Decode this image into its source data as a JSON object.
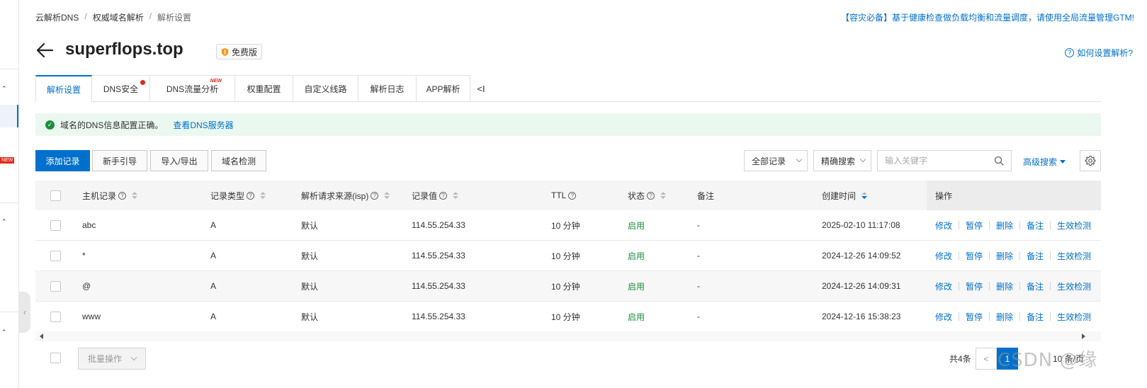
{
  "breadcrumb": [
    "云解析DNS",
    "权威域名解析",
    "解析设置"
  ],
  "breadcrumb_sep": "/",
  "top_notice": "【容灾必备】基于健康检查做负载均衡和流量调度，请使用全局流量管理GTM!",
  "domain": "superflops.top",
  "plan_badge": "免费版",
  "help_link": "如何设置解析?",
  "left_sidebar": {
    "new_tag": "NEW"
  },
  "tabs": [
    {
      "label": "解析设置",
      "active": true
    },
    {
      "label": "DNS安全",
      "badge": "dot"
    },
    {
      "label": "DNS流量分析",
      "badge": "NEW"
    },
    {
      "label": "权重配置"
    },
    {
      "label": "自定义线路"
    },
    {
      "label": "解析日志"
    },
    {
      "label": "APP解析"
    }
  ],
  "tab_collapse": "<I",
  "dns_status": {
    "message": "域名的DNS信息配置正确。",
    "link": "查看DNS服务器"
  },
  "toolbar": {
    "add_record": "添加记录",
    "guide": "新手引导",
    "import_export": "导入/导出",
    "domain_check": "域名检测",
    "record_filter": "全部记录",
    "search_mode": "精确搜索",
    "search_placeholder": "输入关键字",
    "advanced_search": "高级搜索"
  },
  "table": {
    "headers": {
      "host": "主机记录",
      "type": "记录类型",
      "line": "解析请求来源(isp)",
      "value": "记录值",
      "ttl": "TTL",
      "status": "状态",
      "remark": "备注",
      "created": "创建时间",
      "actions": "操作"
    },
    "actions": [
      "修改",
      "暂停",
      "删除",
      "备注",
      "生效检测"
    ],
    "rows": [
      {
        "host": "abc",
        "type": "A",
        "line": "默认",
        "value": "114.55.254.33",
        "ttl": "10 分钟",
        "status": "启用",
        "remark": "-",
        "created": "2025-02-10 11:17:08"
      },
      {
        "host": "*",
        "type": "A",
        "line": "默认",
        "value": "114.55.254.33",
        "ttl": "10 分钟",
        "status": "启用",
        "remark": "-",
        "created": "2024-12-26 14:09:52"
      },
      {
        "host": "@",
        "type": "A",
        "line": "默认",
        "value": "114.55.254.33",
        "ttl": "10 分钟",
        "status": "启用",
        "remark": "-",
        "created": "2024-12-26 14:09:31"
      },
      {
        "host": "www",
        "type": "A",
        "line": "默认",
        "value": "114.55.254.33",
        "ttl": "10 分钟",
        "status": "启用",
        "remark": "-",
        "created": "2024-12-16 15:38:23"
      }
    ]
  },
  "footer": {
    "batch_ops": "批量操作",
    "total": "共4条",
    "prev": "<",
    "current_page": "1",
    "page_size": "10 条/页"
  },
  "watermark": "CSDN @缘",
  "colors": {
    "primary": "#0070cc",
    "success": "#1e8e3e",
    "danger": "#e0281b",
    "notice_bg": "#ebf8f0"
  }
}
